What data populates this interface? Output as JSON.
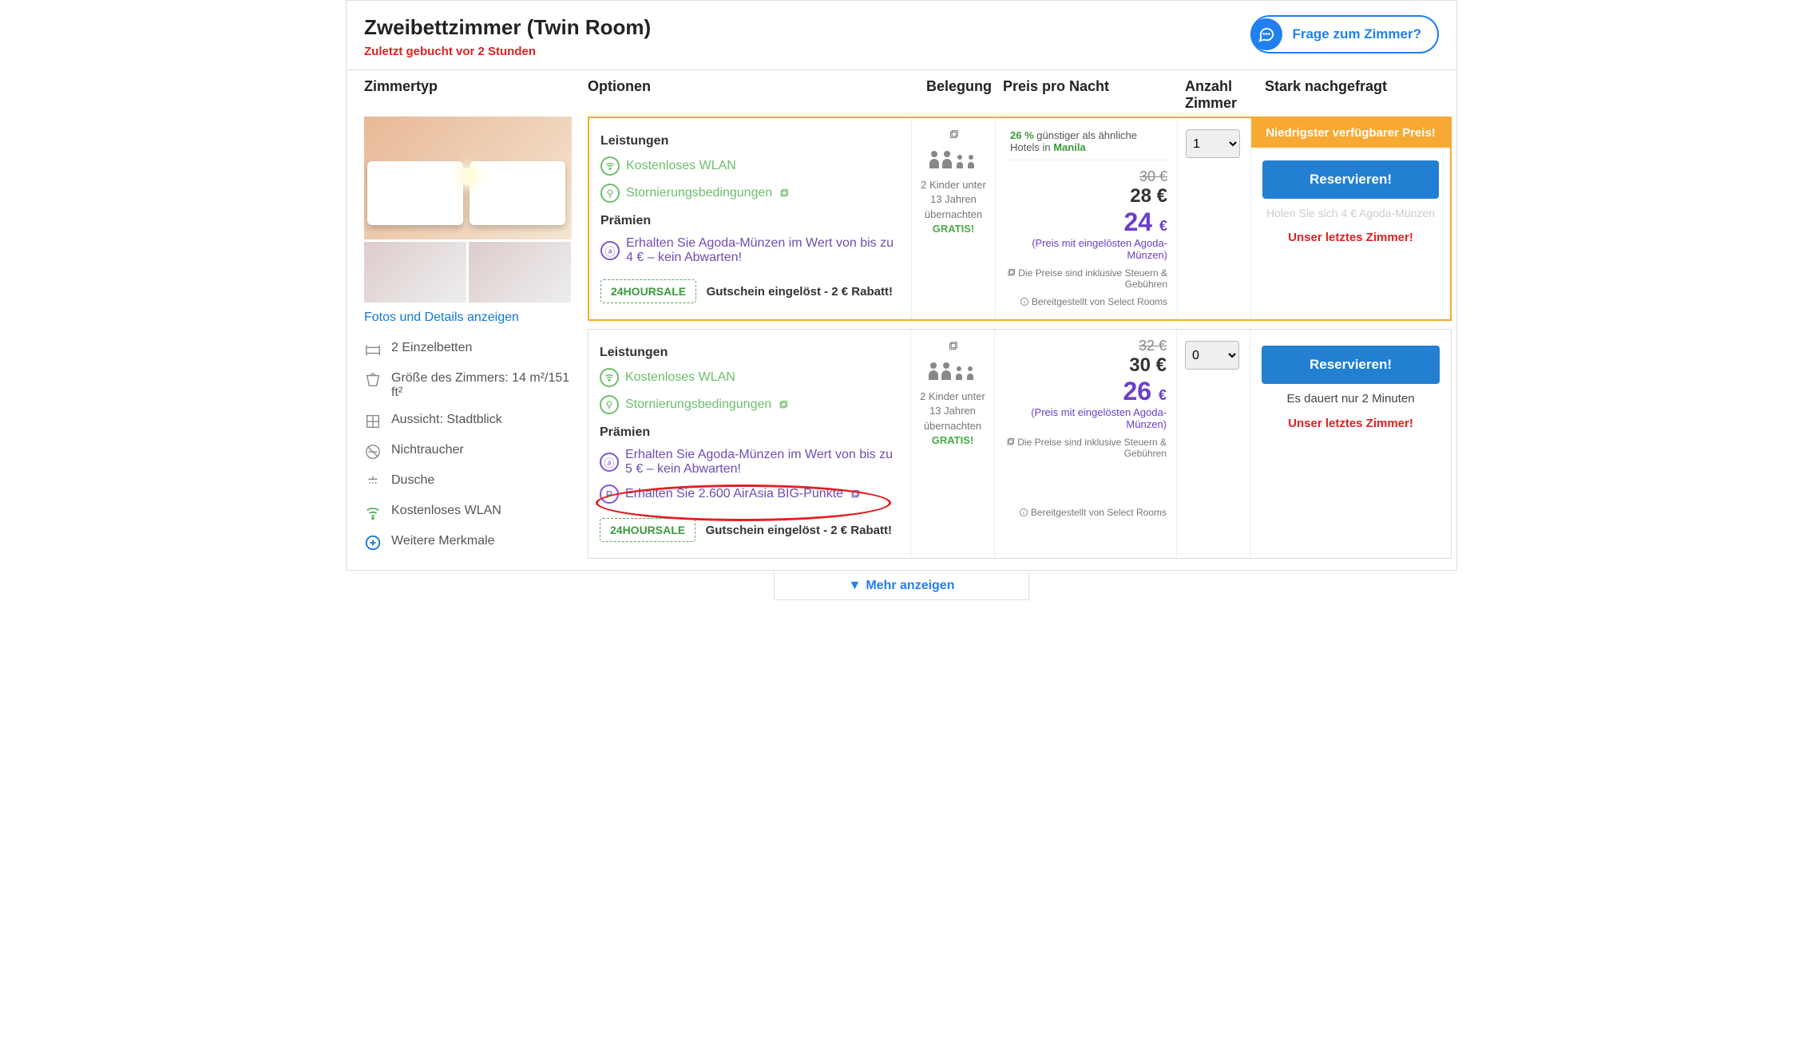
{
  "header": {
    "room_title": "Zweibettzimmer (Twin Room)",
    "last_booked": "Zuletzt gebucht vor 2 Stunden",
    "ask_room": "Frage zum Zimmer?"
  },
  "columns": {
    "type": "Zimmertyp",
    "options": "Optionen",
    "occupancy": "Belegung",
    "price": "Preis pro Nacht",
    "count": "Anzahl Zimmer",
    "demand": "Stark nachgefragt"
  },
  "sidebar": {
    "photos_link": "Fotos und Details anzeigen",
    "amenities": {
      "beds": "2 Einzelbetten",
      "size": "Größe des Zimmers: 14 m²/151 ft²",
      "view": "Aussicht: Stadtblick",
      "smoking": "Nichtraucher",
      "shower": "Dusche",
      "wifi": "Kostenloses WLAN",
      "more": "Weitere Merkmale"
    }
  },
  "offers": [
    {
      "options": {
        "leistungen_title": "Leistungen",
        "wifi": "Kostenloses WLAN",
        "cancel": "Stornierungsbedingungen",
        "praemien_title": "Prämien",
        "coins_line": "Erhalten Sie Agoda-Münzen im Wert von bis zu 4 € – kein Abwarten!",
        "coupon_code": "24HOURSALE",
        "coupon_text": "Gutschein eingelöst - 2 € Rabatt!"
      },
      "occupancy": {
        "text": "2 Kinder unter 13 Jahren übernachten",
        "gratis": "GRATIS!"
      },
      "price": {
        "ribbon_pct": "26 %",
        "ribbon_rest": " günstiger als ähnliche Hotels in ",
        "ribbon_city": "Manila",
        "strike": "30 €",
        "shown": "28 €",
        "big": "24 ",
        "cur": "€",
        "coin_note": "(Preis mit eingelösten Agoda-Münzen)",
        "tax_note": "Die Preise sind inklusive Steuern & Gebühren",
        "provider_note": "Bereitgestellt von Select Rooms"
      },
      "count_value": "1",
      "action": {
        "lowest": "Niedrigster verfügbarer Preis!",
        "reserve": "Reservieren!",
        "pale": "Holen Sie sich 4 € Agoda-Münzen",
        "red": "Unser letztes Zimmer!"
      }
    },
    {
      "options": {
        "leistungen_title": "Leistungen",
        "wifi": "Kostenloses WLAN",
        "cancel": "Stornierungsbedingungen",
        "praemien_title": "Prämien",
        "coins_line": "Erhalten Sie Agoda-Münzen im Wert von bis zu 5 € – kein Abwarten!",
        "points_line": "Erhalten Sie 2.600 AirAsia BIG-Punkte",
        "coupon_code": "24HOURSALE",
        "coupon_text": "Gutschein eingelöst - 2 € Rabatt!"
      },
      "occupancy": {
        "text": "2 Kinder unter 13 Jahren übernachten",
        "gratis": "GRATIS!"
      },
      "price": {
        "strike": "32 €",
        "shown": "30 €",
        "big": "26 ",
        "cur": "€",
        "coin_note": "(Preis mit eingelösten Agoda-Münzen)",
        "tax_note": "Die Preise sind inklusive Steuern & Gebühren",
        "provider_note": "Bereitgestellt von Select Rooms"
      },
      "count_value": "0",
      "action": {
        "reserve": "Reservieren!",
        "dark": "Es dauert nur 2 Minuten",
        "red": "Unser letztes Zimmer!"
      }
    }
  ],
  "show_more": "Mehr anzeigen"
}
